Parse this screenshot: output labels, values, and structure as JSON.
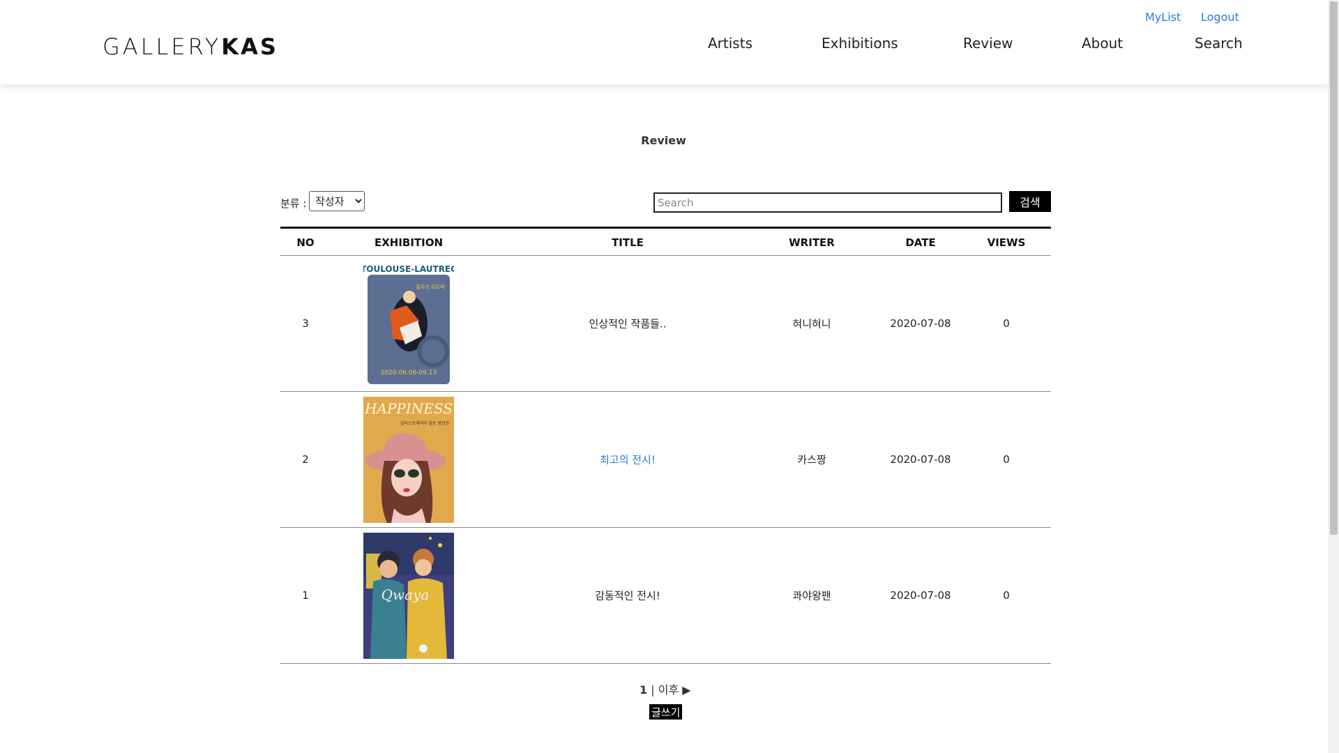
{
  "header": {
    "logo_light": "GALLERY",
    "logo_bold": "KAS",
    "util_links": [
      "MyList",
      "Logout"
    ],
    "nav": [
      "Artists",
      "Exhibitions",
      "Review",
      "About",
      "Search"
    ]
  },
  "page": {
    "title": "Review"
  },
  "filter": {
    "label": "분류 :",
    "selected": "작성자",
    "search_placeholder": "Search",
    "search_value": "",
    "search_button": "검색"
  },
  "table": {
    "columns": [
      "NO",
      "EXHIBITION",
      "TITLE",
      "WRITER",
      "DATE",
      "VIEWS"
    ],
    "rows": [
      {
        "no": "3",
        "exhibition_poster": "toulouse-lautrec-poster",
        "poster_title": "TOULOUSE-LAUTREC",
        "poster_dates": "2020.06.06-09.13",
        "title": "인상적인 작품들..",
        "writer": "혀니혀니",
        "date": "2020-07-08",
        "views": "0"
      },
      {
        "no": "2",
        "exhibition_poster": "happiness-poster",
        "poster_title": "HAPPINESS",
        "title": "최고의 전시!",
        "writer": "카스짱",
        "date": "2020-07-08",
        "views": "0"
      },
      {
        "no": "1",
        "exhibition_poster": "qwaya-poster",
        "poster_title": "Qwaya",
        "title": "감동적인 전시!",
        "writer": "콰야왕팬",
        "date": "2020-07-08",
        "views": "0"
      }
    ]
  },
  "pager": {
    "current": "1",
    "separator": "|",
    "next": "이후"
  },
  "write_button": "글쓰기",
  "colors": {
    "link": "#2a7bd6",
    "button_bg": "#000000"
  }
}
